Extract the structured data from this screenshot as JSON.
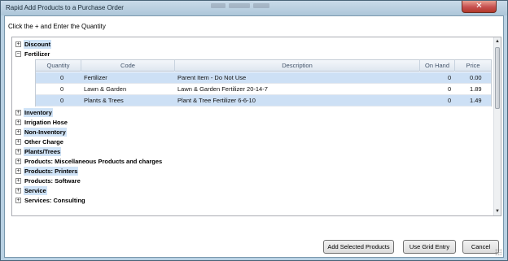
{
  "window": {
    "title": "Rapid Add Products to a Purchase Order",
    "close_glyph": "✕"
  },
  "instruction": "Click the + and Enter the Quantity",
  "tree": {
    "nodes": [
      {
        "label": "Discount",
        "expander": "+",
        "selected": true
      },
      {
        "label": "Fertilizer",
        "expander": "−",
        "selected": false
      },
      {
        "label": "Inventory",
        "expander": "+",
        "selected": true
      },
      {
        "label": "Irrigation Hose",
        "expander": "+",
        "selected": false
      },
      {
        "label": "Non-Inventory",
        "expander": "+",
        "selected": true
      },
      {
        "label": "Other Charge",
        "expander": "+",
        "selected": false
      },
      {
        "label": "Plants/Trees",
        "expander": "+",
        "selected": true
      },
      {
        "label": "Products: Miscellaneous Products and charges",
        "expander": "+",
        "selected": false
      },
      {
        "label": "Products: Printers",
        "expander": "+",
        "selected": true
      },
      {
        "label": "Products: Software",
        "expander": "+",
        "selected": false
      },
      {
        "label": "Service",
        "expander": "+",
        "selected": true
      },
      {
        "label": "Services: Consulting",
        "expander": "+",
        "selected": false
      }
    ]
  },
  "grid": {
    "columns": [
      "Quantity",
      "Code",
      "Description",
      "On Hand",
      "Price"
    ],
    "rows": [
      {
        "quantity": "0",
        "code": "Fertilizer",
        "description": "Parent Item - Do Not Use",
        "on_hand": "0",
        "price": "0.00"
      },
      {
        "quantity": "0",
        "code": "Lawn & Garden",
        "description": "Lawn & Garden Fertilizer 20-14-7",
        "on_hand": "0",
        "price": "1.89"
      },
      {
        "quantity": "0",
        "code": "Plants & Trees",
        "description": "Plant & Tree Fertilizer 6-6-10",
        "on_hand": "0",
        "price": "1.49"
      }
    ]
  },
  "scrollbar": {
    "up_glyph": "▲",
    "down_glyph": "▼"
  },
  "buttons": {
    "add_selected": "Add Selected Products",
    "use_grid_entry": "Use Grid Entry",
    "cancel": "Cancel"
  },
  "colors": {
    "selection": "#cfe3f7",
    "grid_row_highlight": "#cde0f5",
    "frame": "#b9d1e3"
  }
}
